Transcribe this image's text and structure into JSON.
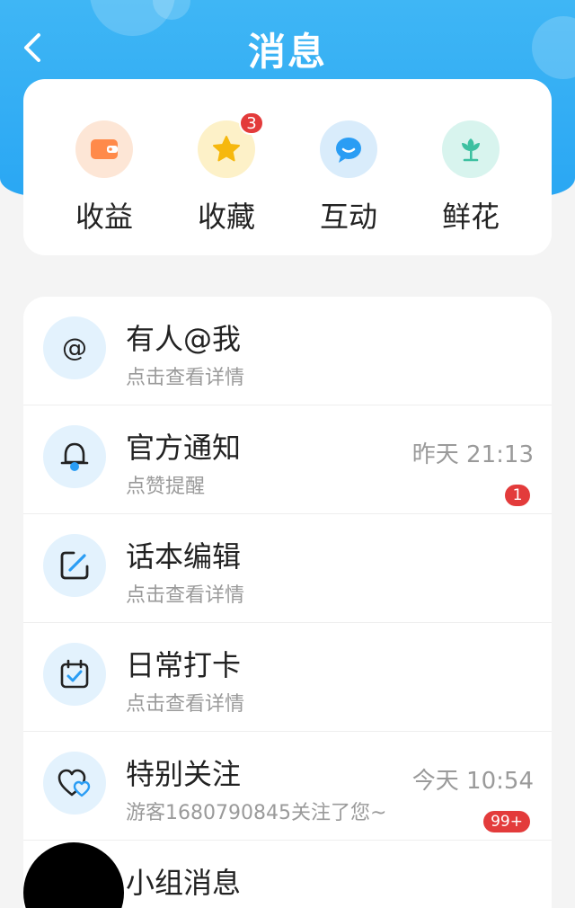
{
  "header": {
    "title": "消息",
    "back_icon": "chevron-left-icon"
  },
  "quick_actions": [
    {
      "label": "收益",
      "icon": "wallet-icon",
      "color": "#ff8a4a",
      "bg": "#fde6d6"
    },
    {
      "label": "收藏",
      "icon": "star-icon",
      "color": "#f4b400",
      "bg": "#fdf1c8",
      "badge": "3"
    },
    {
      "label": "互动",
      "icon": "chat-bubble-icon",
      "color": "#2a9df4",
      "bg": "#d9ecfb"
    },
    {
      "label": "鲜花",
      "icon": "flower-icon",
      "color": "#3cc0a0",
      "bg": "#d8f4ee"
    }
  ],
  "messages": [
    {
      "title": "有人@我",
      "subtitle": "点击查看详情",
      "icon": "at-sign-icon",
      "time": "",
      "badge": ""
    },
    {
      "title": "官方通知",
      "subtitle": "点赞提醒",
      "icon": "bell-icon",
      "time": "昨天 21:13",
      "badge": "1"
    },
    {
      "title": "话本编辑",
      "subtitle": "点击查看详情",
      "icon": "edit-icon",
      "time": "",
      "badge": ""
    },
    {
      "title": "日常打卡",
      "subtitle": "点击查看详情",
      "icon": "calendar-check-icon",
      "time": "",
      "badge": ""
    },
    {
      "title": "特别关注",
      "subtitle": "游客1680790845关注了您~",
      "icon": "heart-icon",
      "time": "今天 10:54",
      "badge": "99+"
    },
    {
      "title": "小组消息",
      "subtitle": "",
      "icon": "group-icon",
      "time": "",
      "badge": ""
    }
  ],
  "colors": {
    "header_blue": "#2aa7f3",
    "badge_red": "#e33b3b"
  }
}
